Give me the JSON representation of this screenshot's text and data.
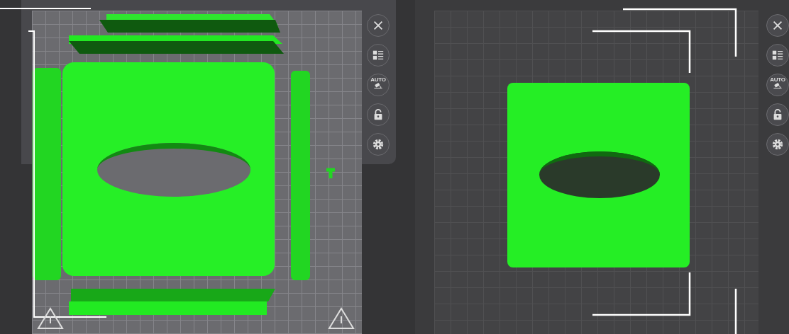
{
  "viewports": [
    {
      "toolbar": [
        {
          "kind": "close"
        },
        {
          "kind": "list"
        },
        {
          "kind": "auto",
          "label": "AUTO"
        },
        {
          "kind": "lock",
          "locked": false
        },
        {
          "kind": "settings"
        }
      ]
    },
    {
      "toolbar": [
        {
          "kind": "close"
        },
        {
          "kind": "list"
        },
        {
          "kind": "auto",
          "label": "AUTO"
        },
        {
          "kind": "lock",
          "locked": false
        },
        {
          "kind": "settings"
        }
      ]
    }
  ]
}
